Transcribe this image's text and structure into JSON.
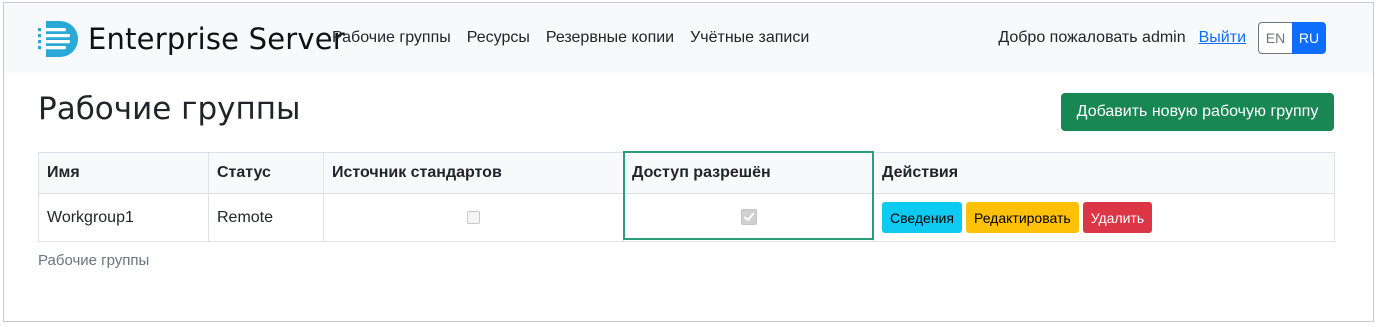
{
  "brand": {
    "name": "Enterprise Server",
    "logo_icon": "database-stack-icon"
  },
  "nav": {
    "items": [
      {
        "label": "Рабочие группы"
      },
      {
        "label": "Ресурсы"
      },
      {
        "label": "Резервные копии"
      },
      {
        "label": "Учётные записи"
      }
    ],
    "welcome": "Добро пожаловать admin",
    "logout": "Выйти",
    "lang": {
      "en": "EN",
      "ru": "RU",
      "active": "RU"
    }
  },
  "page": {
    "title": "Рабочие группы",
    "add_button": "Добавить новую рабочую группу"
  },
  "table": {
    "headers": {
      "name": "Имя",
      "status": "Статус",
      "source": "Источник стандартов",
      "access": "Доступ разрешён",
      "actions": "Действия"
    },
    "rows": [
      {
        "name": "Workgroup1",
        "status": "Remote",
        "source_checked": false,
        "access_checked": true,
        "actions": {
          "details": "Сведения",
          "edit": "Редактировать",
          "delete": "Удалить"
        }
      }
    ]
  },
  "footer": {
    "breadcrumb": "Рабочие группы"
  },
  "colors": {
    "navbar_bg": "#f8f9fa",
    "primary": "#0d6efd",
    "success": "#198754",
    "info": "#0dcaf0",
    "warning": "#ffc107",
    "danger": "#dc3545",
    "highlight": "#2a9d7f"
  }
}
